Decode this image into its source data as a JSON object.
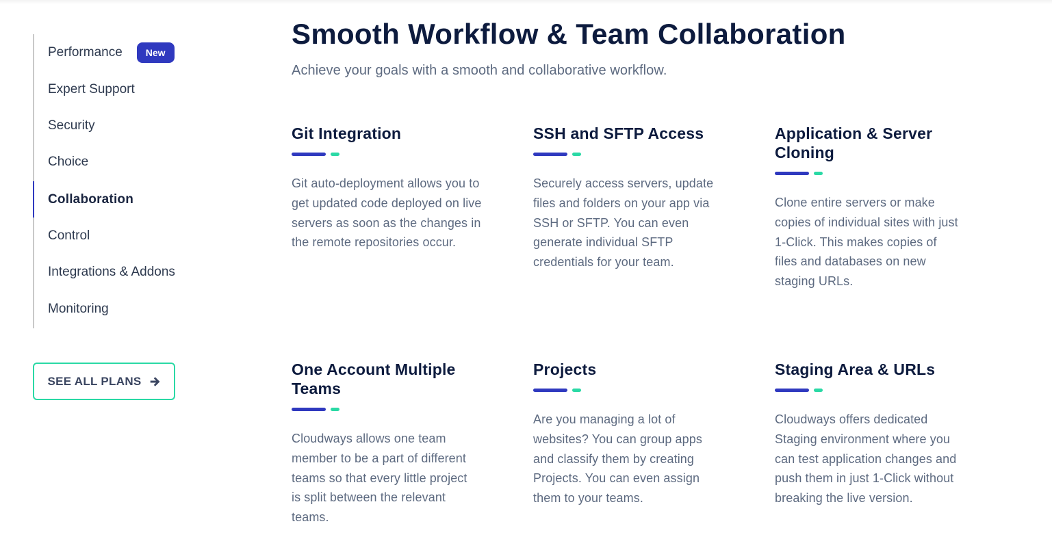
{
  "sidebar": {
    "items": [
      {
        "label": "Performance",
        "badge": "New",
        "active": false
      },
      {
        "label": "Expert Support",
        "active": false
      },
      {
        "label": "Security",
        "active": false
      },
      {
        "label": "Choice",
        "active": false
      },
      {
        "label": "Collaboration",
        "active": true
      },
      {
        "label": "Control",
        "active": false
      },
      {
        "label": "Integrations & Addons",
        "active": false
      },
      {
        "label": "Monitoring",
        "active": false
      }
    ],
    "cta_label": "SEE ALL PLANS",
    "cta_icon": "arrow-right-icon"
  },
  "main": {
    "title": "Smooth Workflow & Team Collaboration",
    "subtitle": "Achieve your goals with a smooth and collaborative workflow.",
    "features": [
      {
        "title": "Git Integration",
        "description": "Git auto-deployment allows you to get updated code deployed on live servers as soon as the changes in the remote repositories occur."
      },
      {
        "title": "SSH and SFTP Access",
        "description": "Securely access servers, update files and folders on your app via SSH or SFTP. You can even generate individual SFTP credentials for your team."
      },
      {
        "title": "Application & Server Cloning",
        "description": "Clone entire servers or make copies of individual sites with just 1-Click. This makes copies of files and databases on new staging URLs."
      },
      {
        "title": "One Account Multiple Teams",
        "description": "Cloudways allows one team member to be a part of different teams so that every little project is split between the relevant teams."
      },
      {
        "title": "Projects",
        "description": "Are you managing a lot of websites? You can group apps and classify them by creating Projects. You can even assign them to your teams."
      },
      {
        "title": "Staging Area & URLs",
        "description": "Cloudways offers dedicated Staging environment where you can test application changes and push them in just 1-Click without breaking the live version."
      }
    ]
  },
  "colors": {
    "accent_primary": "#2f39bf",
    "accent_secondary": "#2ad9a5",
    "heading": "#0d1b3e",
    "body_text": "#5d6a80"
  }
}
